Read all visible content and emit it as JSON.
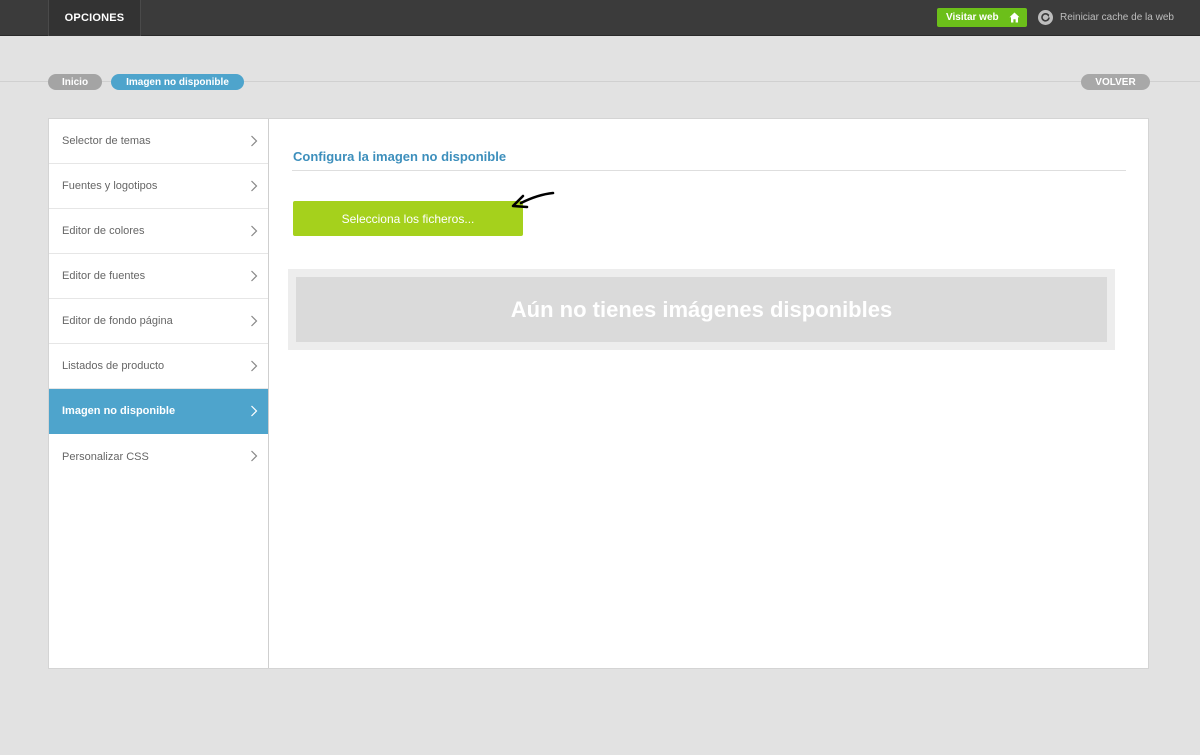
{
  "topbar": {
    "opciones_label": "OPCIONES",
    "visit_label": "Visitar web",
    "reset_cache_label": "Reiniciar cache de la web"
  },
  "breadcrumb": {
    "inicio": "Inicio",
    "current": "Imagen no disponible",
    "volver": "VOLVER"
  },
  "sidebar": {
    "items": [
      {
        "label": "Selector de temas"
      },
      {
        "label": "Fuentes y logotipos"
      },
      {
        "label": "Editor de colores"
      },
      {
        "label": "Editor de fuentes"
      },
      {
        "label": "Editor de fondo página"
      },
      {
        "label": "Listados de producto"
      },
      {
        "label": "Imagen no disponible",
        "active": true
      },
      {
        "label": "Personalizar CSS"
      }
    ]
  },
  "content": {
    "title": "Configura la imagen no disponible",
    "select_button": "Selecciona los ficheros...",
    "empty_message": "Aún no tienes imágenes disponibles"
  },
  "colors": {
    "accent_blue": "#4ea4cc",
    "green_button": "#a5d11c",
    "visit_green": "#6cbf1a"
  }
}
